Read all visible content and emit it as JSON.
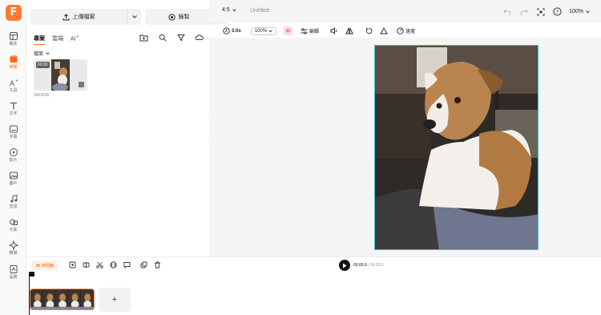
{
  "logo": {
    "letter": "F"
  },
  "sidebar": {
    "items": [
      {
        "label": "範本",
        "icon": "templates-icon"
      },
      {
        "label": "媒體",
        "icon": "media-icon",
        "active": true
      },
      {
        "label": "工具",
        "icon": "ai-tools-icon"
      },
      {
        "label": "文字",
        "icon": "text-icon"
      },
      {
        "label": "字幕",
        "icon": "subtitles-icon"
      },
      {
        "label": "影片",
        "icon": "video-icon"
      },
      {
        "label": "圖片",
        "icon": "image-icon"
      },
      {
        "label": "音訊",
        "icon": "audio-icon"
      },
      {
        "label": "元素",
        "icon": "elements-icon"
      },
      {
        "label": "轉場",
        "icon": "transitions-icon"
      },
      {
        "label": "品牌",
        "icon": "brand-icon"
      }
    ]
  },
  "media": {
    "upload_label": "上傳檔案",
    "record_label": "錄製",
    "tabs": [
      {
        "label": "專案",
        "active": true
      },
      {
        "label": "雲端",
        "active": false
      },
      {
        "label": "AI",
        "active": false
      }
    ],
    "ai_badge": "✦",
    "filter_label": "檔案",
    "clip": {
      "duration": "00:03",
      "name": "2834230"
    }
  },
  "topbar": {
    "aspect": "4:5",
    "title": "Untitled",
    "zoom": "100%"
  },
  "toolbar": {
    "duration": "3.0s",
    "scale": "100%",
    "ai_label": "AI",
    "edit_label": "編輯",
    "speed_label": "速度"
  },
  "timeline": {
    "ai_tool_label": "時間軸",
    "current_time": "00:00.0",
    "total_time": "00:03.0",
    "add_label": "+"
  },
  "colors": {
    "accent": "#ff6a1a",
    "frame": "#39c6d4",
    "clip_border": "#ff8a3d"
  }
}
